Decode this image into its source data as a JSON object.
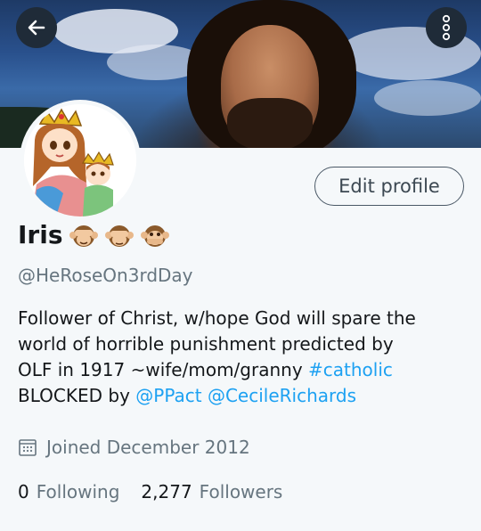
{
  "header": {
    "back_icon": "arrow-left-icon",
    "more_icon": "vertical-dots-icon"
  },
  "profile": {
    "name": "Iris",
    "name_emoji": [
      "see-no-evil-monkey",
      "see-no-evil-monkey",
      "speak-no-evil-monkey"
    ],
    "handle": "@HeRoseOn3rdDay",
    "edit_button_label": "Edit profile",
    "bio": {
      "line1": "Follower of Christ, w/hope God will spare the",
      "line2": "world of horrible punishment predicted by",
      "line3_text": "OLF in 1917 ~wife/mom/granny ",
      "line3_hashtag": "#catholic",
      "line4_text": "BLOCKED by ",
      "line4_mention1": "@PPact",
      "line4_mention2": "@CecileRichards"
    },
    "joined": "Joined December 2012",
    "following_count": "0",
    "following_label": "Following",
    "followers_count": "2,277",
    "followers_label": "Followers"
  },
  "colors": {
    "link": "#1da1f2",
    "secondary_text": "#66757f",
    "background": "#f5f8fa"
  }
}
